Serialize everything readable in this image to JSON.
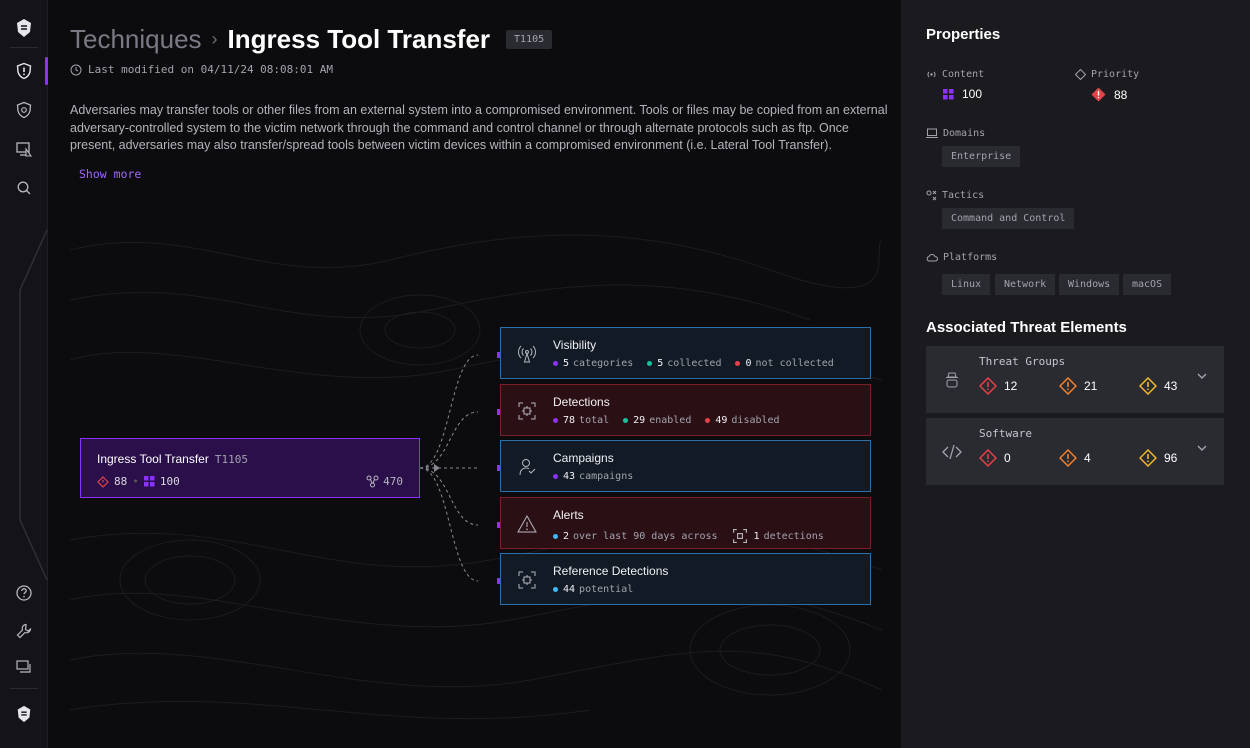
{
  "breadcrumb": {
    "parent": "Techniques",
    "separator": "›"
  },
  "page": {
    "title": "Ingress Tool Transfer",
    "technique_id": "T1105",
    "last_modified": "Last modified on 04/11/24 08:08:01 AM",
    "description": "Adversaries may transfer tools or other files from an external system into a compromised environment. Tools or files may be copied from an external adversary-controlled system to the victim network through the command and control channel or through alternate protocols such as ftp. Once present, adversaries may also transfer/spread tools between victim devices within a compromised environment (i.e. Lateral Tool Transfer).",
    "show_more": "Show more"
  },
  "root_node": {
    "title": "Ingress Tool Transfer",
    "id": "T1105",
    "priority": "88",
    "content": "100",
    "links": "470"
  },
  "cards": {
    "visibility": {
      "title": "Visibility",
      "categories": "5",
      "categories_label": "categories",
      "collected": "5",
      "collected_label": "collected",
      "not_collected": "0",
      "not_collected_label": "not collected"
    },
    "detections": {
      "title": "Detections",
      "total": "78",
      "total_label": "total",
      "enabled": "29",
      "enabled_label": "enabled",
      "disabled": "49",
      "disabled_label": "disabled"
    },
    "campaigns": {
      "title": "Campaigns",
      "count": "43",
      "count_label": "campaigns"
    },
    "alerts": {
      "title": "Alerts",
      "count": "2",
      "count_label": "over last 90 days across",
      "detections": "1",
      "detections_label": "detections"
    },
    "reference": {
      "title": "Reference Detections",
      "count": "44",
      "count_label": "potential"
    }
  },
  "properties": {
    "title": "Properties",
    "content_label": "Content",
    "content_value": "100",
    "priority_label": "Priority",
    "priority_value": "88",
    "domains_label": "Domains",
    "domains": [
      "Enterprise"
    ],
    "tactics_label": "Tactics",
    "tactics": [
      "Command and Control"
    ],
    "platforms_label": "Platforms",
    "platforms": [
      "Linux",
      "Network",
      "Windows",
      "macOS"
    ]
  },
  "associated": {
    "title": "Associated Threat Elements",
    "threat_groups": {
      "name": "Threat Groups",
      "high": "12",
      "medium": "21",
      "low": "43"
    },
    "software": {
      "name": "Software",
      "high": "0",
      "medium": "4",
      "low": "96"
    }
  },
  "colors": {
    "accent": "#8c32ff",
    "high": "#e5414b",
    "medium": "#f0822d",
    "low": "#f2b830",
    "collected": "#18c29c",
    "info": "#3fb8f5"
  }
}
